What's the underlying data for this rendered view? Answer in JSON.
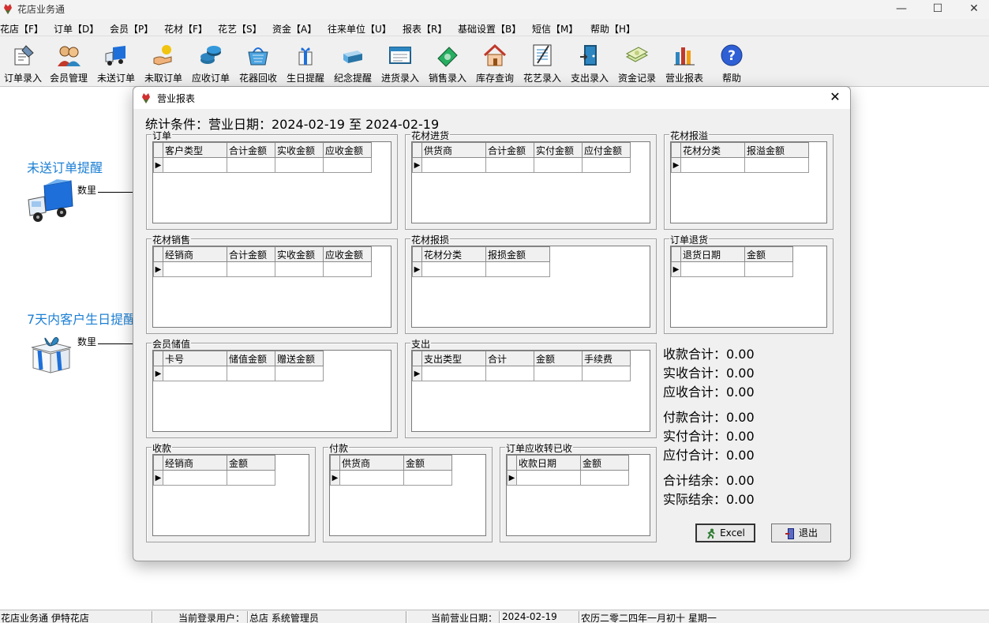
{
  "app": {
    "title": "花店业务通"
  },
  "window_controls": {
    "minimize": "—",
    "maximize": "☐",
    "close": "✕"
  },
  "menu": [
    "花店【F】",
    "订单【D】",
    "会员【P】",
    "花材【F】",
    "花艺【S】",
    "资金【A】",
    "往来单位【U】",
    "报表【R】",
    "基础设置【B】",
    "短信【M】",
    "帮助【H】"
  ],
  "toolbar": [
    {
      "label": "订单录入",
      "icon": "order-entry-icon"
    },
    {
      "label": "会员管理",
      "icon": "members-icon"
    },
    {
      "label": "未送订单",
      "icon": "delivery-truck-icon"
    },
    {
      "label": "未取订单",
      "icon": "pickup-hand-icon"
    },
    {
      "label": "应收订单",
      "icon": "coins-icon"
    },
    {
      "label": "花器回收",
      "icon": "basket-icon"
    },
    {
      "label": "生日提醒",
      "icon": "gift-icon"
    },
    {
      "label": "纪念提醒",
      "icon": "box-icon"
    },
    {
      "label": "进货录入",
      "icon": "purchase-icon"
    },
    {
      "label": "销售录入",
      "icon": "sales-icon"
    },
    {
      "label": "库存查询",
      "icon": "house-icon"
    },
    {
      "label": "花艺录入",
      "icon": "notebook-icon"
    },
    {
      "label": "支出录入",
      "icon": "door-icon"
    },
    {
      "label": "资金记录",
      "icon": "money-icon"
    },
    {
      "label": "营业报表",
      "icon": "bar-chart-icon"
    },
    {
      "label": "帮助",
      "icon": "help-icon"
    }
  ],
  "desktop": {
    "unsent_title": "未送订单提醒",
    "unsent_qty_label": "数里",
    "birthday_title": "7天内客户生日提醒",
    "birthday_qty_label": "数里"
  },
  "status": {
    "app_name": "花店业务通 伊特花店",
    "user_label": "当前登录用户：",
    "user_value": "总店  系统管理员",
    "date_label": "当前营业日期：",
    "date_value": "2024-02-19",
    "lunar": "农历二零二四年一月初十  星期一"
  },
  "dialog": {
    "title": "营业报表",
    "close": "✕",
    "condition": "统计条件：营业日期：2024-02-19 至 2024-02-19",
    "groups": {
      "order": {
        "title": "订单",
        "columns": [
          "客户类型",
          "合计金额",
          "实收金额",
          "应收金额"
        ]
      },
      "purchase": {
        "title": "花材进货",
        "columns": [
          "供货商",
          "合计金额",
          "实付金额",
          "应付金额"
        ]
      },
      "overflow": {
        "title": "花材报溢",
        "columns": [
          "花材分类",
          "报溢金额"
        ]
      },
      "sales": {
        "title": "花材销售",
        "columns": [
          "经销商",
          "合计金额",
          "实收金额",
          "应收金额"
        ]
      },
      "loss": {
        "title": "花材报损",
        "columns": [
          "花材分类",
          "报损金额"
        ]
      },
      "returns": {
        "title": "订单退货",
        "columns": [
          "退货日期",
          "金额"
        ]
      },
      "deposit": {
        "title": "会员储值",
        "columns": [
          "卡号",
          "储值金额",
          "赠送金额"
        ]
      },
      "expense": {
        "title": "支出",
        "columns": [
          "支出类型",
          "合计",
          "金额",
          "手续费"
        ]
      },
      "receipt": {
        "title": "收款",
        "columns": [
          "经销商",
          "金额"
        ]
      },
      "payment": {
        "title": "付款",
        "columns": [
          "供货商",
          "金额"
        ]
      },
      "transfer": {
        "title": "订单应收转已收",
        "columns": [
          "收款日期",
          "金额"
        ]
      }
    },
    "summary": {
      "received_total": "收款合计：0.00",
      "actual_received": "实收合计：0.00",
      "receivable_total": "应收合计：0.00",
      "paid_total": "付款合计：0.00",
      "actual_paid": "实付合计：0.00",
      "payable_total": "应付合计：0.00",
      "balance_total": "合计结余：0.00",
      "actual_balance": "实际结余：0.00"
    },
    "buttons": {
      "excel": "Excel",
      "exit": "退出"
    }
  }
}
